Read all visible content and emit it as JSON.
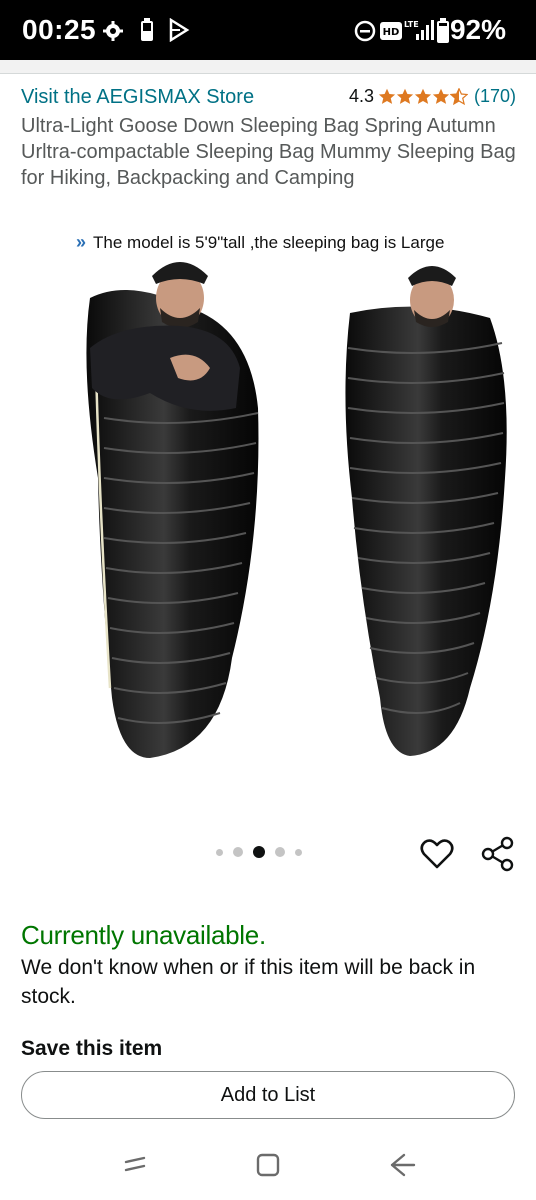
{
  "status_bar": {
    "time": "00:25",
    "battery": "92%",
    "icons": [
      "gear-icon",
      "battery-saver-icon",
      "play-icon",
      "do-not-disturb-icon",
      "hd-icon",
      "lte-signal-icon",
      "battery-icon"
    ]
  },
  "product": {
    "store_link": "Visit the AEGISMAX Store",
    "rating": "4.3",
    "rating_count": "(170)",
    "title": "Ultra-Light Goose Down Sleeping Bag Spring Autumn Urltra-compactable Sleeping Bag Mummy Sleeping Bag for Hiking, Backpacking and Camping",
    "image_caption": "The model is 5'9\"tall ,the sleeping bag is Large",
    "caption_arrows": "»",
    "carousel_dots": 5,
    "carousel_active_index": 2
  },
  "availability": {
    "status": "Currently unavailable.",
    "note": "We don't know when or if this item will be back in stock."
  },
  "save": {
    "heading": "Save this item",
    "button_label": "Add to List"
  },
  "colors": {
    "link": "#007185",
    "star": "#de7921",
    "unavailable": "#007600"
  }
}
